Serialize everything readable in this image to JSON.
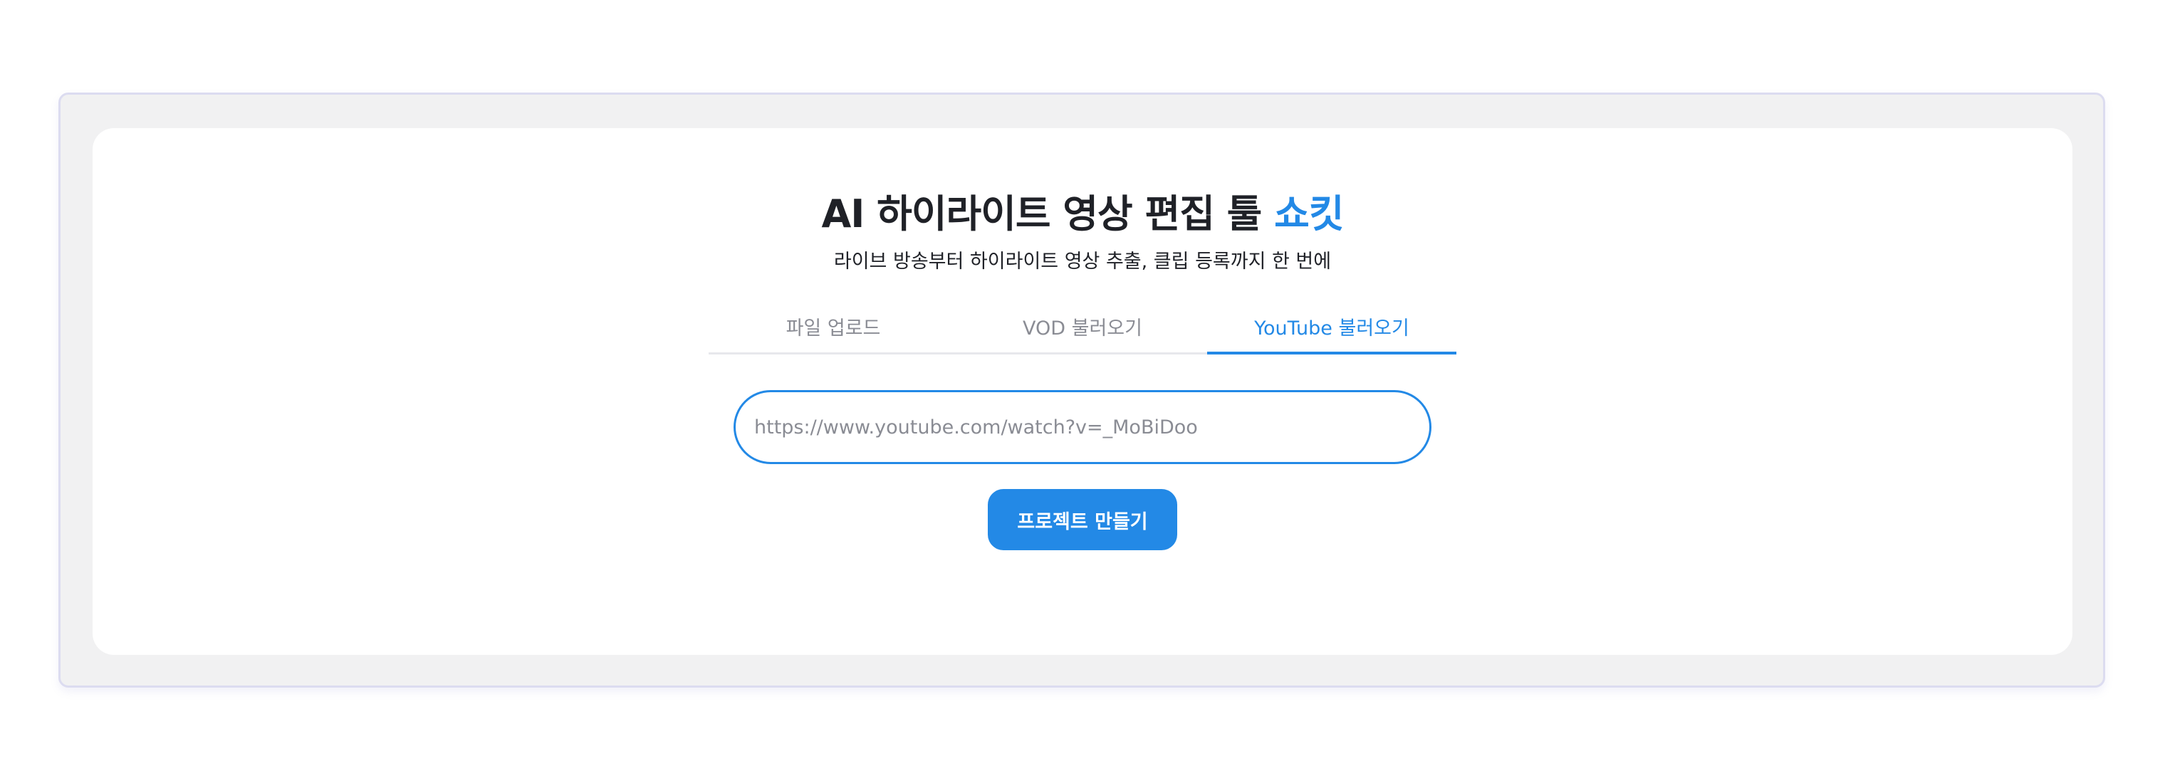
{
  "header": {
    "title_main": "AI 하이라이트 영상 편집 툴 ",
    "title_accent": "쇼킷",
    "subtitle": "라이브 방송부터 하이라이트 영상 추출, 클립 등록까지 한 번에"
  },
  "tabs": [
    {
      "label": "파일 업로드",
      "active": false
    },
    {
      "label": "VOD 불러오기",
      "active": false
    },
    {
      "label": "YouTube 불러오기",
      "active": true
    }
  ],
  "url_input": {
    "value": "",
    "placeholder": "https://www.youtube.com/watch?v=_MoBiDoo"
  },
  "create_button": {
    "label": "프로젝트 만들기"
  },
  "colors": {
    "accent": "#2389e6",
    "title_text": "#1f2127",
    "inactive_tab": "#8a8c94"
  }
}
